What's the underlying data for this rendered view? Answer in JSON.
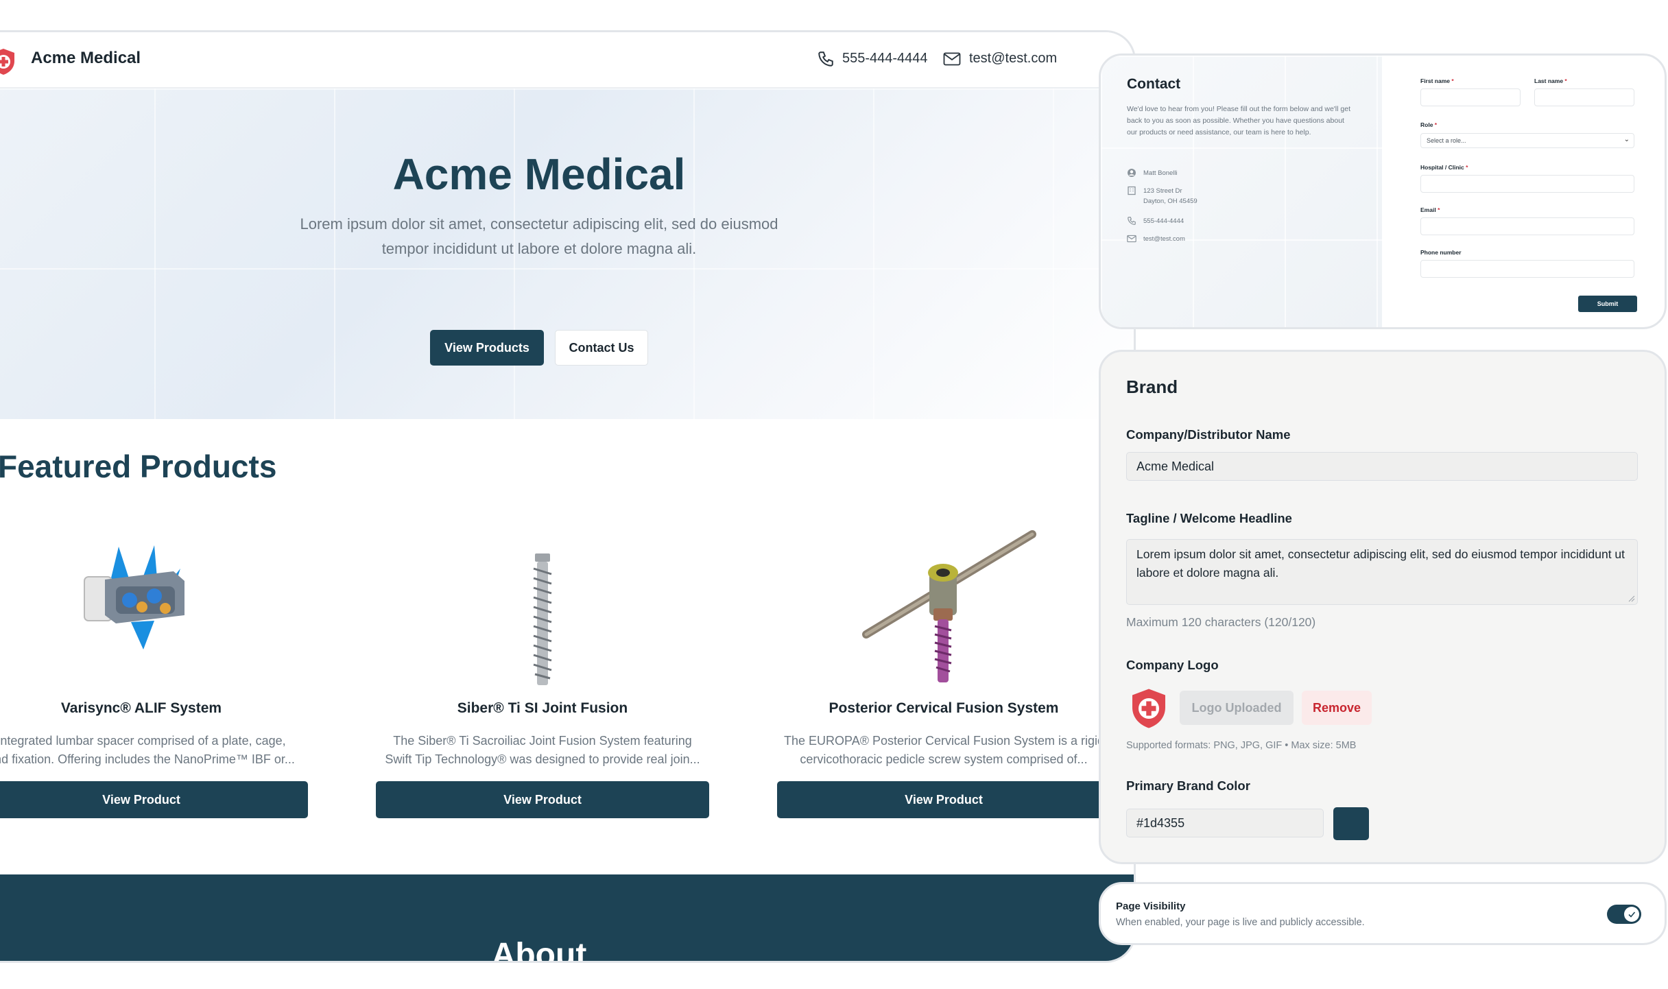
{
  "site": {
    "brand_name": "Acme Medical",
    "header_phone": "555-444-4444",
    "header_email": "test@test.com",
    "hero_title": "Acme Medical",
    "hero_subtitle": "Lorem ipsum dolor sit amet, consectetur adipiscing elit, sed do eiusmod tempor incididunt ut labore et dolore magna ali.",
    "btn_view_products": "View Products",
    "btn_contact_us": "Contact Us",
    "featured_title": "Featured Products",
    "products": [
      {
        "title": "Varisync® ALIF System",
        "desc1": "Integrated lumbar spacer comprised of a plate, cage,",
        "desc2": "and fixation. Offering includes the NanoPrime™ IBF or...",
        "button": "View Product"
      },
      {
        "title": "Siber® Ti SI Joint Fusion",
        "desc1": "The Siber® Ti Sacroiliac Joint Fusion System featuring",
        "desc2": "Swift Tip Technology® was designed to provide real join...",
        "button": "View Product"
      },
      {
        "title": "Posterior Cervical Fusion System",
        "desc1": "The EUROPA® Posterior Cervical Fusion System is a rigid",
        "desc2": "cervicothoracic pedicle screw system comprised of...",
        "button": "View Product"
      }
    ],
    "about_title": "About"
  },
  "contact": {
    "title": "Contact",
    "description": "We'd love to hear from you! Please fill out the form below and we'll get back to you as soon as possible. Whether you have questions about our products or need assistance, our team is here to help.",
    "name": "Matt Bonelli",
    "address_line1": "123 Street Dr",
    "address_line2": "Dayton, OH 45459",
    "phone": "555-444-4444",
    "email": "test@test.com",
    "form": {
      "first_name": "First name",
      "last_name": "Last name",
      "role": "Role",
      "role_placeholder": "Select a role...",
      "hospital": "Hospital / Clinic",
      "email": "Email",
      "phone": "Phone number",
      "required_mark": "*",
      "submit": "Submit"
    }
  },
  "brand": {
    "title": "Brand",
    "company_label": "Company/Distributor Name",
    "company_value": "Acme Medical",
    "tagline_label": "Tagline / Welcome Headline",
    "tagline_value": "Lorem ipsum dolor sit amet, consectetur adipiscing elit, sed do eiusmod tempor incididunt ut labore et dolore magna ali.",
    "tagline_hint": "Maximum 120 characters (120/120)",
    "logo_label": "Company Logo",
    "logo_uploaded": "Logo Uploaded",
    "logo_remove": "Remove",
    "logo_hint": "Supported formats: PNG, JPG, GIF • Max size: 5MB",
    "color_label": "Primary Brand Color",
    "color_value": "#1d4355"
  },
  "visibility": {
    "title": "Page Visibility",
    "description": "When enabled, your page is live and publicly accessible.",
    "enabled": true
  },
  "colors": {
    "primary": "#1d4355",
    "logo_red": "#e0474f",
    "danger": "#c8252f"
  },
  "icons": [
    "shield-cross-icon",
    "phone-icon",
    "mail-icon",
    "user-icon",
    "building-icon",
    "chevron-down-icon",
    "check-icon"
  ]
}
